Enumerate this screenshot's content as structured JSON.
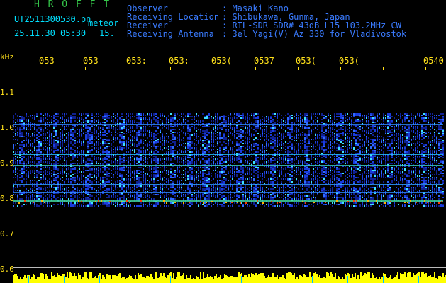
{
  "header": {
    "logo": "H R O F F T",
    "filename": "UT2511300530.pn",
    "meteor_label": "meteor",
    "datetime": "25.11.30 05:30",
    "meteor_count": "15.",
    "observer_label": "Observer",
    "observer_value": ": Masaki Kano",
    "location_label": "Receiving Location",
    "location_value": ": Shibukawa, Gunma, Japan",
    "receiver_label": "Receiver",
    "receiver_value": ": RTL-SDR SDR# 43dB L15 103.2MHz CW",
    "antenna_label": "Receiving Antenna",
    "antenna_value": ": 3el Yagi(V) Az 330 for Vladivostok"
  },
  "axis": {
    "unit": "kHz",
    "y_ticks": [
      "1.1",
      "1.0",
      "0.9",
      "0.8",
      "0.7",
      "0.6"
    ],
    "x_ticks": [
      "053",
      "053",
      "053:",
      "053:",
      "053(",
      "0537",
      "053(",
      "053(",
      "0540"
    ]
  },
  "colors": {
    "background": "#000000",
    "header_blue": "#3a7bff",
    "header_cyan": "#00e0ff",
    "logo_green": "#35c84a",
    "tick_yellow": "#ffe11a",
    "signal_blue": "#1a3cff",
    "signal_cyan": "#00ffd0",
    "signal_red": "#ff3a00",
    "baseline_yellow": "#ffff00"
  }
}
